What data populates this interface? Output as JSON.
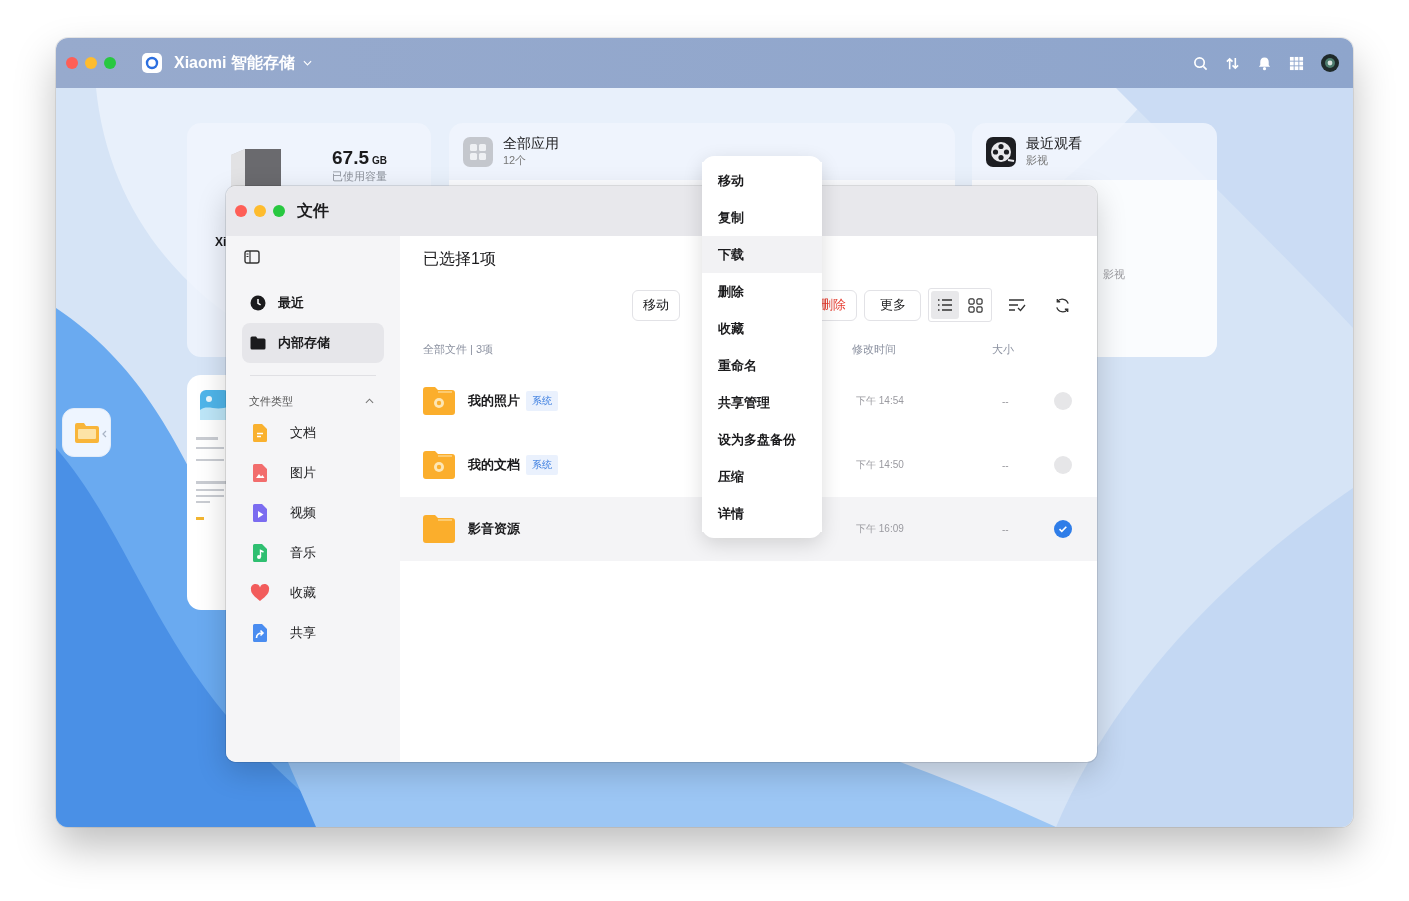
{
  "app": {
    "title": "Xiaomi 智能存储"
  },
  "storage_card": {
    "device_name": "Xi",
    "used": "67.5",
    "unit": "GB",
    "label": "已使用容量"
  },
  "apps_card": {
    "title": "全部应用",
    "count": "12个"
  },
  "recent_card": {
    "title": "最近观看",
    "subtitle": "影视",
    "item_label": "影视"
  },
  "files_window": {
    "title": "文件",
    "sidebar": {
      "items": [
        {
          "label": "最近",
          "selected": false
        },
        {
          "label": "内部存储",
          "selected": true
        }
      ],
      "section": {
        "title": "文件类型",
        "expanded": true,
        "items": [
          {
            "label": "文档",
            "color": "#f9b12f"
          },
          {
            "label": "图片",
            "color": "#f26d6d"
          },
          {
            "label": "视频",
            "color": "#7b6cf0"
          },
          {
            "label": "音乐",
            "color": "#2fbf71"
          },
          {
            "label": "收藏",
            "color": "#f25c5c"
          },
          {
            "label": "共享",
            "color": "#4a8cf0"
          }
        ]
      }
    },
    "header": "已选择1项",
    "toolbar": {
      "buttons": [
        {
          "label": "移动",
          "kind": "normal"
        },
        {
          "label": "删除",
          "kind": "danger"
        },
        {
          "label": "更多",
          "kind": "normal"
        }
      ],
      "views": [
        {
          "kind": "list",
          "selected": true
        },
        {
          "kind": "grid",
          "selected": false
        }
      ]
    },
    "breadcrumb": "全部文件 | 3项",
    "columns": [
      "修改时间",
      "大小"
    ],
    "rows": [
      {
        "name": "我的照片",
        "tag": "系统",
        "time": "下午 14:54",
        "size": "--",
        "selected": false
      },
      {
        "name": "我的文档",
        "tag": "系统",
        "time": "下午 14:50",
        "size": "--",
        "selected": false
      },
      {
        "name": "影音资源",
        "time": "下午 16:09",
        "size": "--",
        "selected": true
      }
    ]
  },
  "context_menu": {
    "items": [
      {
        "label": "移动",
        "hovered": false
      },
      {
        "label": "复制",
        "hovered": false
      },
      {
        "label": "下载",
        "hovered": true
      },
      {
        "label": "删除",
        "hovered": false
      },
      {
        "label": "收藏",
        "hovered": false
      },
      {
        "label": "重命名",
        "hovered": false
      },
      {
        "label": "共享管理",
        "hovered": false
      },
      {
        "label": "设为多盘备份",
        "hovered": false
      },
      {
        "label": "压缩",
        "hovered": false
      },
      {
        "label": "详情",
        "hovered": false
      }
    ]
  }
}
